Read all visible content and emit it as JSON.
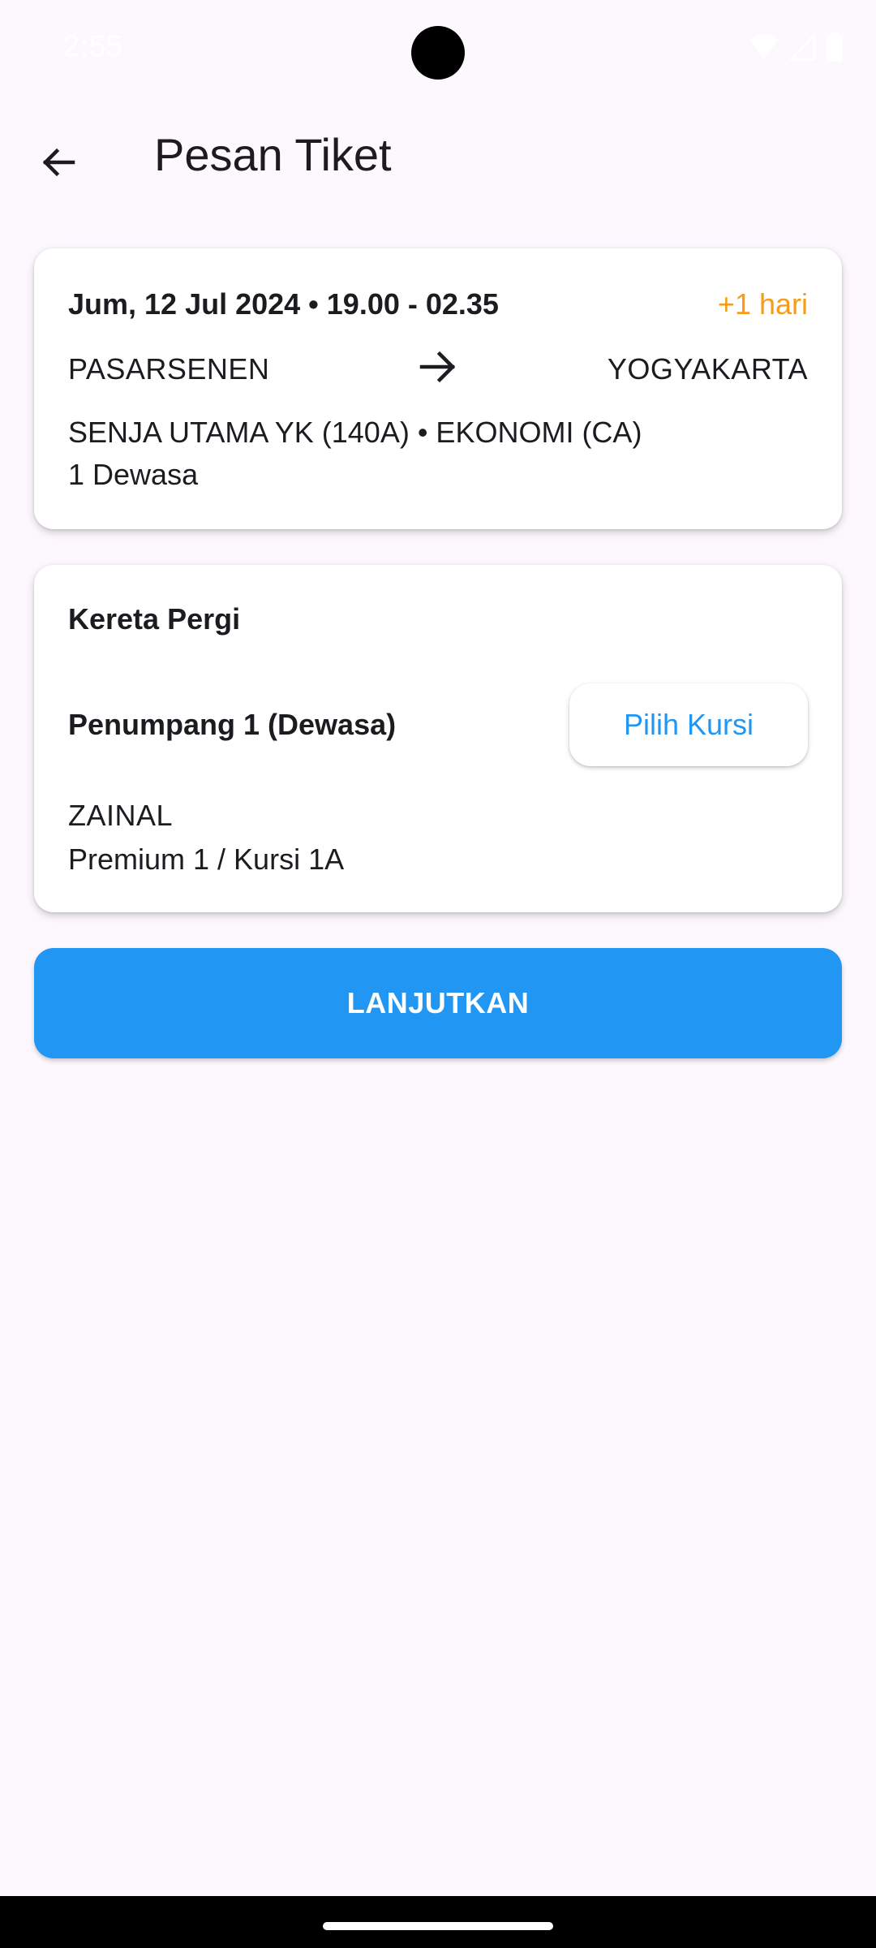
{
  "status_bar": {
    "time": "2:55",
    "icons": [
      "wifi-icon",
      "signal-icon",
      "battery-icon"
    ]
  },
  "app_bar": {
    "back_icon": "arrow-back-icon",
    "title": "Pesan Tiket"
  },
  "trip": {
    "datetime": "Jum, 12 Jul 2024 • 19.00 - 02.35",
    "plus_day": "+1 hari",
    "from": "PASARSENEN",
    "to": "YOGYAKARTA",
    "route_icon": "arrow-right-icon",
    "train": "SENJA UTAMA YK (140A) • EKONOMI (CA)",
    "passengers": "1 Dewasa"
  },
  "departure": {
    "section_title": "Kereta Pergi",
    "passenger_label": "Penumpang 1 (Dewasa)",
    "seat_button": "Pilih Kursi",
    "passenger_name": "ZAINAL",
    "seat_info": "Premium 1 / Kursi 1A"
  },
  "actions": {
    "continue_label": "LANJUTKAN"
  },
  "colors": {
    "background": "#fdf7fe",
    "primary": "#2196f3",
    "accent_orange": "#f59c19",
    "text": "#1d1b20"
  }
}
